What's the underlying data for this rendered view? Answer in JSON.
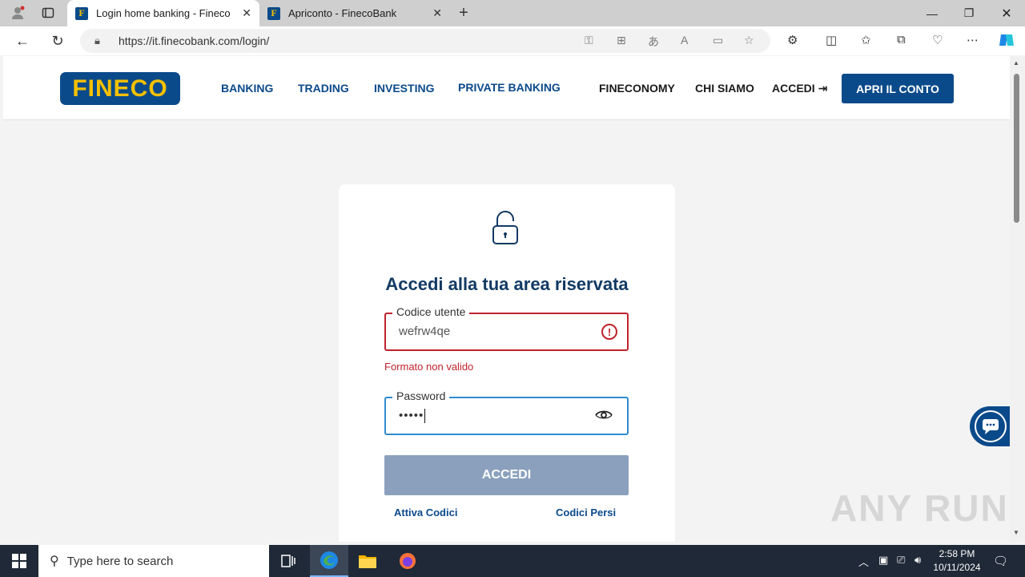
{
  "browser": {
    "tabs": [
      {
        "label": "Login home banking - Fineco",
        "active": true
      },
      {
        "label": "Apriconto - FinecoBank",
        "active": false
      }
    ],
    "url": "https://it.finecobank.com/login/"
  },
  "header": {
    "logo_text": "FINECO",
    "nav": [
      {
        "label": "BANKING"
      },
      {
        "label": "TRADING"
      },
      {
        "label": "INVESTING"
      },
      {
        "label": "PRIVATE BANKING"
      },
      {
        "label": "FINECONOMY"
      },
      {
        "label": "CHI SIAMO"
      },
      {
        "label": "ACCEDI"
      }
    ],
    "cta_label": "APRI IL CONTO"
  },
  "login": {
    "title": "Accedi alla tua area riservata",
    "user_label": "Codice utente",
    "user_value": "wefrw4qe",
    "user_error": "Formato non valido",
    "password_label": "Password",
    "password_value": "•••••",
    "submit_label": "ACCEDI",
    "link_activate": "Attiva Codici",
    "link_lost": "Codici Persi"
  },
  "colors": {
    "brand": "#0b4a8a",
    "logo_text": "#f5c000",
    "error": "#c0232d",
    "focus": "#2e8bd0",
    "button_disabled": "#8aa0bd"
  },
  "watermark": "ANY RUN",
  "taskbar": {
    "search_placeholder": "Type here to search",
    "time": "2:58 PM",
    "date": "10/11/2024"
  }
}
